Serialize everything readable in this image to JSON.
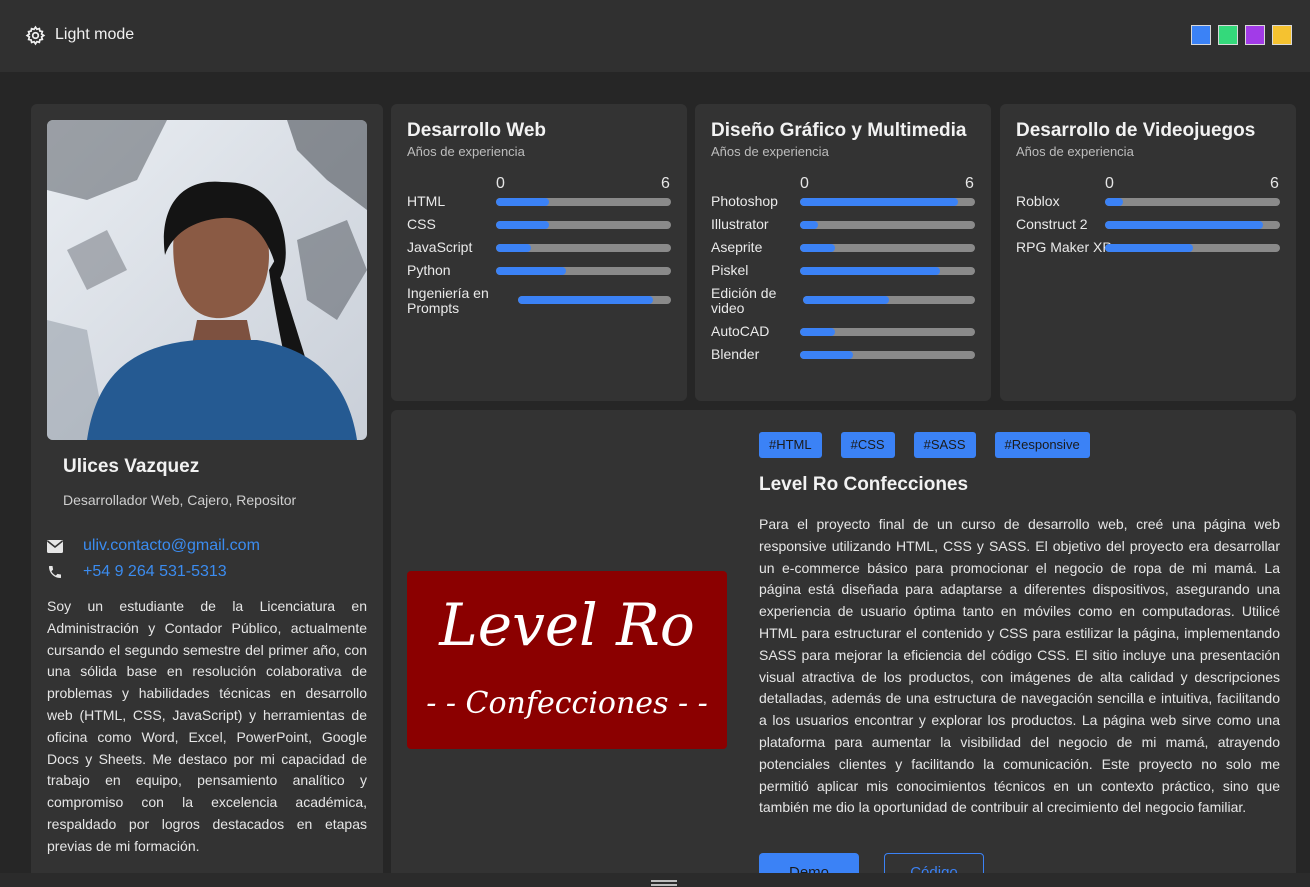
{
  "header": {
    "mode_label": "Light mode",
    "mode_icon": "gear-icon",
    "theme_colors": [
      "#3b82f6",
      "#34d97b",
      "#a23be8",
      "#f5c230"
    ]
  },
  "profile": {
    "name": "Ulices Vazquez",
    "role": "Desarrollador Web, Cajero, Repositor",
    "email": "uliv.contacto@gmail.com",
    "phone": "+54 9 264 531-5313",
    "about": "Soy un estudiante de la Licenciatura en Administración y Contador Público, actualmente cursando el segundo semestre del primer año, con una sólida base en resolución colaborativa de problemas y habilidades técnicas en desarrollo web (HTML, CSS, JavaScript) y herramientas de oficina como Word, Excel, PowerPoint, Google Docs y Sheets. Me destaco por mi capacidad de trabajo en equipo, pensamiento analítico y compromiso con la excelencia académica, respaldado por logros destacados en etapas previas de mi formación."
  },
  "skills": [
    {
      "title": "Desarrollo Web",
      "subtitle": "Años de experiencia",
      "min": "0",
      "max": "6",
      "items": [
        {
          "label": "HTML",
          "value": 1.8
        },
        {
          "label": "CSS",
          "value": 1.8
        },
        {
          "label": "JavaScript",
          "value": 1.2
        },
        {
          "label": "Python",
          "value": 2.4
        },
        {
          "label": "Ingeniería en Prompts",
          "value": 5.3
        }
      ]
    },
    {
      "title": "Diseño Gráfico y Multimedia",
      "subtitle": "Años de experiencia",
      "min": "0",
      "max": "6",
      "items": [
        {
          "label": "Photoshop",
          "value": 5.4
        },
        {
          "label": "Illustrator",
          "value": 0.6
        },
        {
          "label": "Aseprite",
          "value": 1.2
        },
        {
          "label": "Piskel",
          "value": 4.8
        },
        {
          "label": "Edición de video",
          "value": 3.0
        },
        {
          "label": "AutoCAD",
          "value": 1.2
        },
        {
          "label": "Blender",
          "value": 1.8
        }
      ]
    },
    {
      "title": "Desarrollo de Videojuegos",
      "subtitle": "Años de experiencia",
      "min": "0",
      "max": "6",
      "items": [
        {
          "label": "Roblox",
          "value": 0.6
        },
        {
          "label": "Construct 2",
          "value": 5.4
        },
        {
          "label": "RPG Maker XP",
          "value": 3.0
        }
      ]
    }
  ],
  "project": {
    "tags": [
      "#HTML",
      "#CSS",
      "#SASS",
      "#Responsive"
    ],
    "title": "Level Ro Confecciones",
    "logo_line1": "Level Ro",
    "logo_line2": "- - Confecciones - -",
    "description": "Para el proyecto final de un curso de desarrollo web, creé una página web responsive utilizando HTML, CSS y SASS. El objetivo del proyecto era desarrollar un e-commerce básico para promocionar el negocio de ropa de mi mamá. La página está diseñada para adaptarse a diferentes dispositivos, asegurando una experiencia de usuario óptima tanto en móviles como en computadoras. Utilicé HTML para estructurar el contenido y CSS para estilizar la página, implementando SASS para mejorar la eficiencia del código CSS. El sitio incluye una presentación visual atractiva de los productos, con imágenes de alta calidad y descripciones detalladas, además de una estructura de navegación sencilla e intuitiva, facilitando a los usuarios encontrar y explorar los productos. La página web sirve como una plataforma para aumentar la visibilidad del negocio de mi mamá, atrayendo potenciales clientes y facilitando la comunicación. Este proyecto no solo me permitió aplicar mis conocimientos técnicos en un contexto práctico, sino que también me dio la oportunidad de contribuir al crecimiento del negocio familiar.",
    "demo_label": "Demo",
    "code_label": "Código"
  }
}
